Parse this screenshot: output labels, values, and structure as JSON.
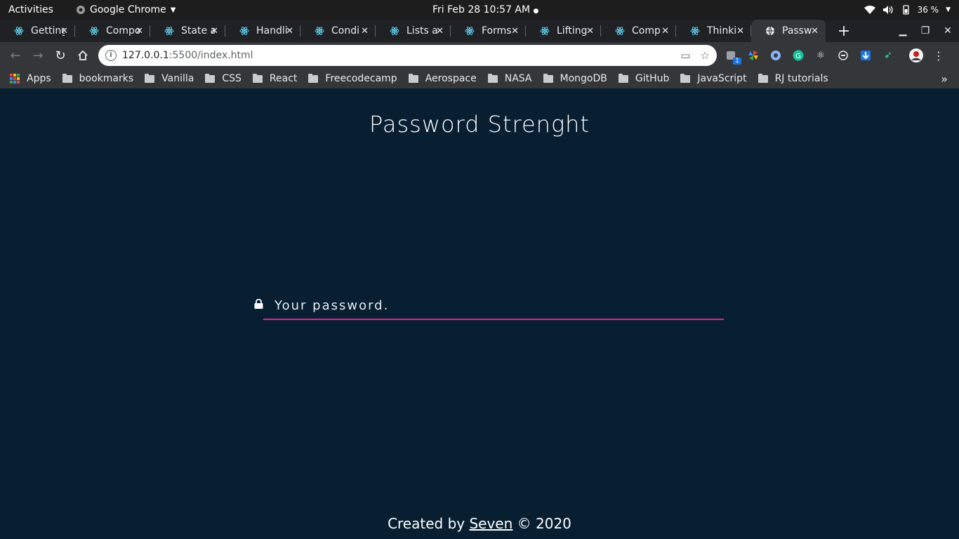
{
  "system": {
    "activities": "Activities",
    "app_name": "Google Chrome",
    "clock": "Fri Feb 28  10:57 AM",
    "battery": "36 %"
  },
  "tabs": [
    {
      "label": "Getting"
    },
    {
      "label": "Compo"
    },
    {
      "label": "State a"
    },
    {
      "label": "Handli"
    },
    {
      "label": "Condi"
    },
    {
      "label": "Lists a"
    },
    {
      "label": "Forms"
    },
    {
      "label": "Lifting"
    },
    {
      "label": "Comp"
    },
    {
      "label": "Thinki"
    },
    {
      "label": "Passw",
      "active": true
    }
  ],
  "address": {
    "host": "127.0.0.1",
    "path": ":5500/index.html"
  },
  "extensions": {
    "badge_count": "1"
  },
  "bookmarks": {
    "apps_label": "Apps",
    "items": [
      "bookmarks",
      "Vanilla",
      "CSS",
      "React",
      "Freecodecamp",
      "Aerospace",
      "NASA",
      "MongoDB",
      "GitHub",
      "JavaScript",
      "RJ tutorials"
    ],
    "more": "»"
  },
  "page": {
    "title": "Password Strenght",
    "password_placeholder": "Your password.",
    "footer_prefix": "Created by ",
    "footer_link": "Seven",
    "footer_suffix": " © 2020"
  },
  "colors": {
    "page_bg": "#071f31",
    "input_underline": "#e91e8c"
  }
}
